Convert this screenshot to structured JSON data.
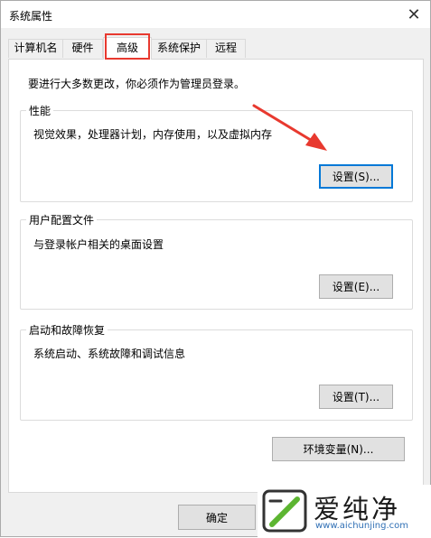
{
  "window": {
    "title": "系统属性",
    "close_label": "✕"
  },
  "tabs": [
    {
      "label": "计算机名",
      "active": false
    },
    {
      "label": "硬件",
      "active": false
    },
    {
      "label": "高级",
      "active": true
    },
    {
      "label": "系统保护",
      "active": false
    },
    {
      "label": "远程",
      "active": false
    }
  ],
  "panel": {
    "notice": "要进行大多数更改，你必须作为管理员登录。"
  },
  "groups": {
    "performance": {
      "label": "性能",
      "desc": "视觉效果，处理器计划，内存使用，以及虚拟内存",
      "button": "设置(S)..."
    },
    "user_profiles": {
      "label": "用户配置文件",
      "desc": "与登录帐户相关的桌面设置",
      "button": "设置(E)..."
    },
    "startup": {
      "label": "启动和故障恢复",
      "desc": "系统启动、系统故障和调试信息",
      "button": "设置(T)..."
    }
  },
  "env_button": "环境变量(N)...",
  "footer": {
    "ok_label": "确定"
  },
  "watermark": {
    "name": "爱纯净",
    "url": "www.aichunjing.com"
  },
  "colors": {
    "highlight": "#e8392f",
    "focus": "#0078d7",
    "logo_green": "#5cb531"
  }
}
